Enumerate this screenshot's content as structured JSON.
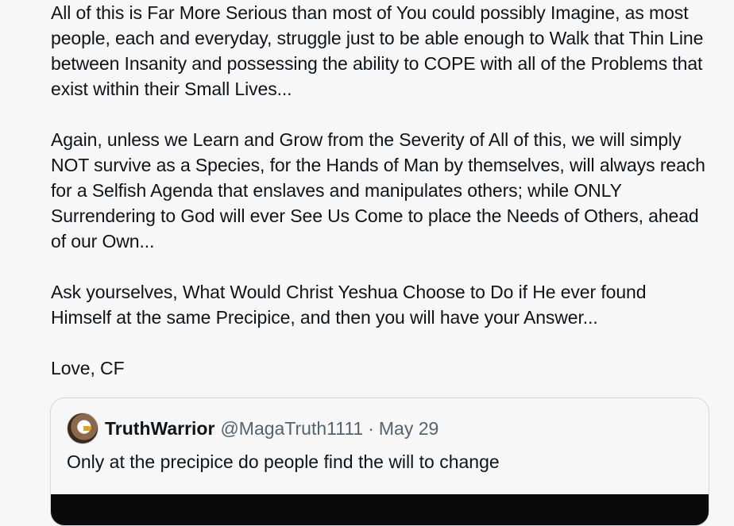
{
  "post": {
    "paragraphs": [
      "All of this is Far More Serious than most of You could possibly Imagine, as most people, each and everyday, struggle just to be able enough to Walk that Thin Line between Insanity and possessing the ability to COPE with all of the Problems that exist within their Small Lives...",
      "Again, unless we Learn and Grow from the Severity of All of this, we will simply NOT survive as a Species, for the Hands of Man by themselves, will always reach for a Selfish Agenda that enslaves and manipulates others; while ONLY Surrendering to God will ever See Us Come to place the Needs of Others, ahead of our Own...",
      "Ask yourselves, What Would Christ Yeshua Choose to Do if He ever found Himself at the same Precipice, and then you will have your Answer...",
      "Love, CF"
    ]
  },
  "quote": {
    "display_name": "TruthWarrior",
    "handle": "@MagaTruth1111",
    "separator": "·",
    "date": "May 29",
    "text": "Only at the precipice do people find the will to change"
  }
}
